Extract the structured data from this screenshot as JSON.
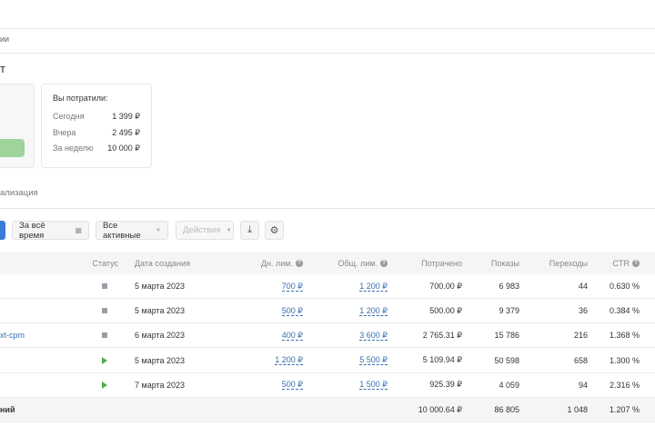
{
  "breadcrumb": "ии",
  "page_title": "т",
  "spent_card": {
    "title": "Вы потратили:",
    "rows": [
      {
        "label": "Сегодня",
        "value": "1 399 ₽"
      },
      {
        "label": "Вчера",
        "value": "2 495 ₽"
      },
      {
        "label": "За неделю",
        "value": "10 000 ₽"
      }
    ]
  },
  "section_tab": "ализация",
  "toolbar": {
    "period": "За всё время",
    "filter": "Все активные",
    "actions": "Действия"
  },
  "table": {
    "headers": {
      "status": "Статус",
      "date": "Дата создания",
      "daily": "Дн. лим.",
      "total": "Общ. лим.",
      "spent": "Потрачено",
      "shows": "Показы",
      "clicks": "Переходы",
      "ctr": "CTR"
    },
    "rows": [
      {
        "name": "",
        "status": "paused",
        "date": "5 марта 2023",
        "daily": "700 ₽",
        "total": "1 200 ₽",
        "spent": "700.00 ₽",
        "shows": "6 983",
        "clicks": "44",
        "ctr": "0.630 %"
      },
      {
        "name": "",
        "status": "paused",
        "date": "5 марта 2023",
        "daily": "500 ₽",
        "total": "1 200 ₽",
        "spent": "500.00 ₽",
        "shows": "9 379",
        "clicks": "36",
        "ctr": "0.384 %"
      },
      {
        "name": "xt-cpm",
        "status": "paused",
        "date": "6 марта 2023",
        "daily": "400 ₽",
        "total": "3 600 ₽",
        "spent": "2 765.31 ₽",
        "shows": "15 786",
        "clicks": "216",
        "ctr": "1.368 %"
      },
      {
        "name": "",
        "status": "active",
        "date": "5 марта 2023",
        "daily": "1 200 ₽",
        "total": "5 500 ₽",
        "spent": "5 109.94 ₽",
        "shows": "50 598",
        "clicks": "658",
        "ctr": "1.300 %"
      },
      {
        "name": "",
        "status": "active",
        "date": "7 марта 2023",
        "daily": "500 ₽",
        "total": "1 500 ₽",
        "spent": "925.39 ₽",
        "shows": "4 059",
        "clicks": "94",
        "ctr": "2.316 %"
      }
    ],
    "total": {
      "label": "ний",
      "spent": "10 000.64 ₽",
      "shows": "86 805",
      "clicks": "1 048",
      "ctr": "1.207 %"
    }
  }
}
